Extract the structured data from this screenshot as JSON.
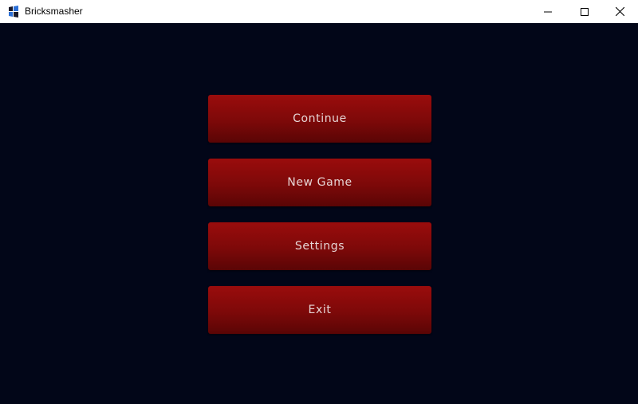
{
  "window": {
    "title": "Bricksmasher",
    "icon": "bricksmasher-app-icon"
  },
  "controls": {
    "minimize_icon": "minimize-icon",
    "maximize_icon": "maximize-icon",
    "close_icon": "close-icon"
  },
  "menu": {
    "items": [
      {
        "label": "Continue"
      },
      {
        "label": "New Game"
      },
      {
        "label": "Settings"
      },
      {
        "label": "Exit"
      }
    ]
  },
  "colors": {
    "background": "#020618",
    "button_top": "#9a0c0c",
    "button_bottom": "#5a0505",
    "button_text": "#e6d6d6"
  }
}
